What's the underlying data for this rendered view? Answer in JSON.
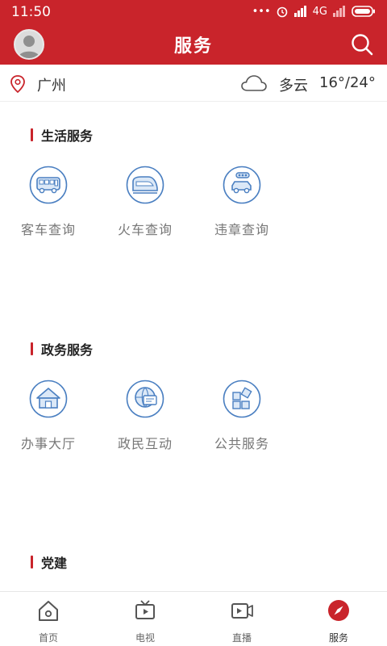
{
  "status": {
    "time": "11:50",
    "network": "4G"
  },
  "header": {
    "title": "服务"
  },
  "location": {
    "city": "广州",
    "weather": "多云",
    "temperature": "16°/24°"
  },
  "sections": [
    {
      "title": "生活服务",
      "items": [
        {
          "label": "客车查询",
          "icon": "bus-icon"
        },
        {
          "label": "火车查询",
          "icon": "train-icon"
        },
        {
          "label": "违章查询",
          "icon": "traffic-violation-icon"
        }
      ]
    },
    {
      "title": "政务服务",
      "items": [
        {
          "label": "办事大厅",
          "icon": "hall-icon"
        },
        {
          "label": "政民互动",
          "icon": "interaction-icon"
        },
        {
          "label": "公共服务",
          "icon": "public-service-icon"
        }
      ]
    },
    {
      "title": "党建"
    }
  ],
  "nav": [
    {
      "label": "首页",
      "icon": "home-icon"
    },
    {
      "label": "电视",
      "icon": "tv-icon"
    },
    {
      "label": "直播",
      "icon": "live-icon"
    },
    {
      "label": "服务",
      "icon": "compass-icon",
      "active": true
    }
  ],
  "colors": {
    "brand": "#c9242b",
    "icon_stroke": "#4a7fc1",
    "icon_fill": "#dbe8f7"
  }
}
